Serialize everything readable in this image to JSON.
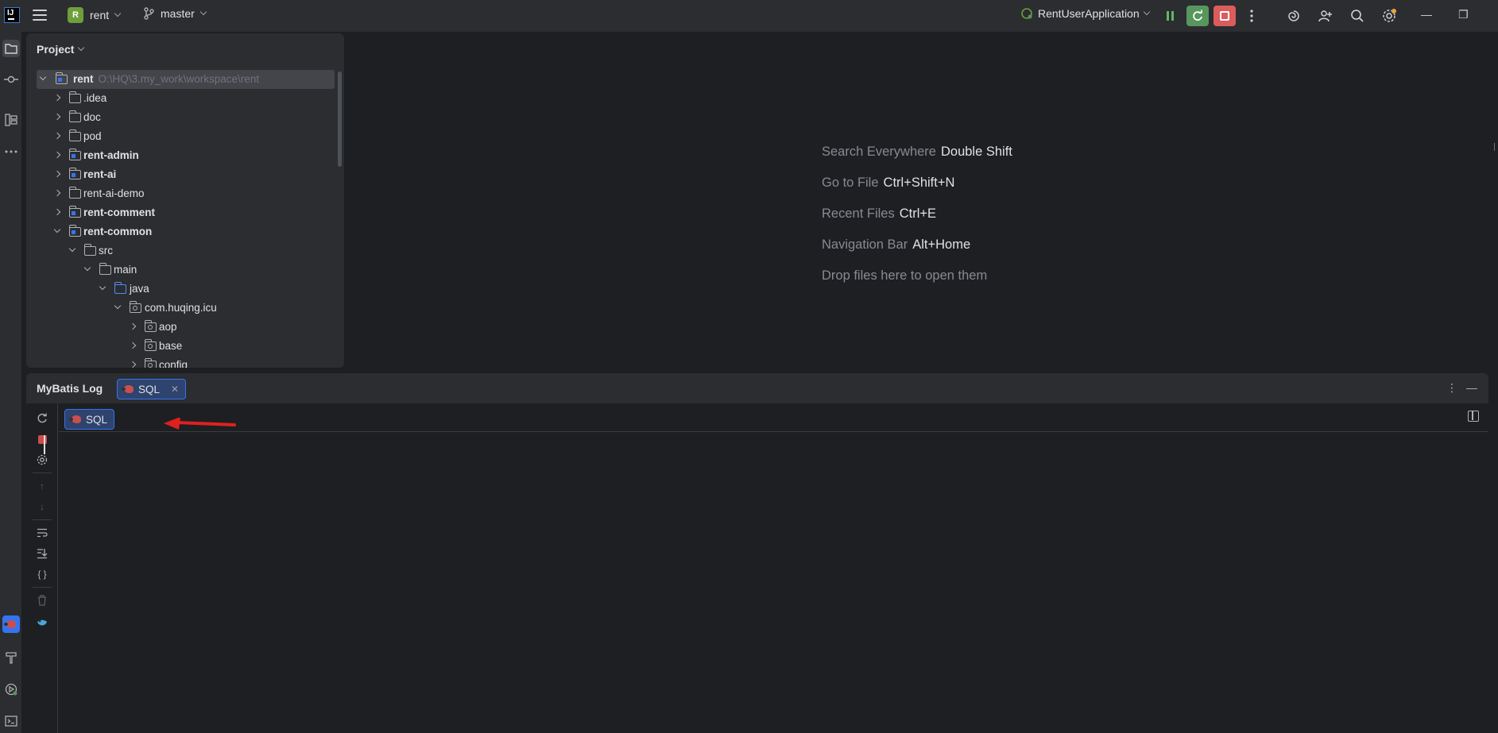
{
  "titlebar": {
    "project_badge": "R",
    "project_name": "rent",
    "branch": "master",
    "run_config": "RentUserApplication"
  },
  "project_panel": {
    "title": "Project",
    "root": {
      "name": "rent",
      "path": "O:\\HQ\\3.my_work\\workspace\\rent"
    },
    "items": [
      {
        "name": ".idea"
      },
      {
        "name": "doc"
      },
      {
        "name": "pod"
      },
      {
        "name": "rent-admin"
      },
      {
        "name": "rent-ai"
      },
      {
        "name": "rent-ai-demo"
      },
      {
        "name": "rent-comment"
      },
      {
        "name": "rent-common"
      },
      {
        "name": "src"
      },
      {
        "name": "main"
      },
      {
        "name": "java"
      },
      {
        "name": "com.huqing.icu"
      },
      {
        "name": "aop"
      },
      {
        "name": "base"
      },
      {
        "name": "config"
      }
    ]
  },
  "editor_hints": [
    {
      "label": "Search Everywhere",
      "key": "Double Shift"
    },
    {
      "label": "Go to File",
      "key": "Ctrl+Shift+N"
    },
    {
      "label": "Recent Files",
      "key": "Ctrl+E"
    },
    {
      "label": "Navigation Bar",
      "key": "Alt+Home"
    },
    {
      "label": "Drop files here to open them",
      "key": ""
    }
  ],
  "bottom_panel": {
    "title": "MyBatis Log",
    "tab_label": "SQL",
    "console_tab_label": "SQL",
    "json_icon_label": "{ }"
  },
  "colors": {
    "accent": "#3574f0",
    "run_green": "#57965c",
    "stop_red": "#db5c5c",
    "annotation_arrow": "#e02020"
  }
}
